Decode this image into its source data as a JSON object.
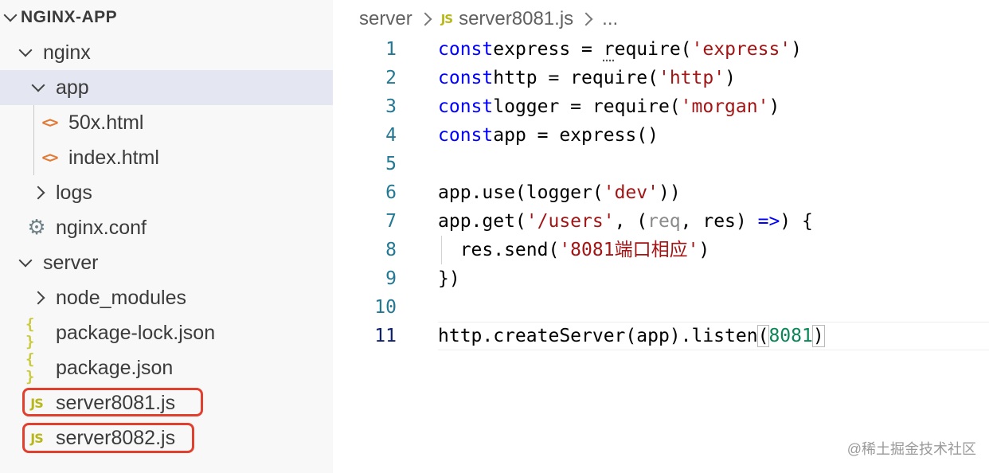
{
  "explorer": {
    "root": "NGINX-APP",
    "items": [
      {
        "label": "nginx",
        "type": "folder",
        "expanded": true
      },
      {
        "label": "app",
        "type": "folder",
        "expanded": true,
        "selected": true
      },
      {
        "label": "50x.html",
        "type": "html"
      },
      {
        "label": "index.html",
        "type": "html"
      },
      {
        "label": "logs",
        "type": "folder",
        "expanded": false
      },
      {
        "label": "nginx.conf",
        "type": "config"
      },
      {
        "label": "server",
        "type": "folder",
        "expanded": true
      },
      {
        "label": "node_modules",
        "type": "folder",
        "expanded": false
      },
      {
        "label": "package-lock.json",
        "type": "json"
      },
      {
        "label": "package.json",
        "type": "json"
      },
      {
        "label": "server8081.js",
        "type": "js",
        "highlighted": true
      },
      {
        "label": "server8082.js",
        "type": "js",
        "highlighted": true
      }
    ],
    "icons": {
      "html": "<>",
      "json": "{ }",
      "js": "JS",
      "config": "⚙"
    },
    "highlight_color": "#e2402f"
  },
  "breadcrumb": {
    "folder": "server",
    "file_icon": "JS",
    "file": "server8081.js",
    "more": "..."
  },
  "editor": {
    "active_line": "11",
    "lines": [
      {
        "n": "1",
        "tokens": [
          [
            "kw",
            "const"
          ],
          [
            "",
            "express = "
          ],
          [
            "dots",
            "r"
          ],
          [
            "",
            "equire("
          ],
          [
            "str",
            "'express'"
          ],
          [
            "",
            ")"
          ]
        ]
      },
      {
        "n": "2",
        "tokens": [
          [
            "kw",
            "const"
          ],
          [
            "",
            "http = require("
          ],
          [
            "str",
            "'http'"
          ],
          [
            "",
            ")"
          ]
        ]
      },
      {
        "n": "3",
        "tokens": [
          [
            "kw",
            "const"
          ],
          [
            "",
            "logger = require("
          ],
          [
            "str",
            "'morgan'"
          ],
          [
            "",
            ")"
          ]
        ]
      },
      {
        "n": "4",
        "tokens": [
          [
            "kw",
            "const"
          ],
          [
            "",
            "app = express()"
          ]
        ]
      },
      {
        "n": "5",
        "tokens": []
      },
      {
        "n": "6",
        "tokens": [
          [
            "",
            "app.use(logger("
          ],
          [
            "str",
            "'dev'"
          ],
          [
            "",
            "))"
          ]
        ]
      },
      {
        "n": "7",
        "tokens": [
          [
            "",
            "app.get("
          ],
          [
            "str",
            "'/users'"
          ],
          [
            "",
            ", ("
          ],
          [
            "dim",
            "req"
          ],
          [
            "",
            ", res) "
          ],
          [
            "kw",
            "=>"
          ],
          [
            "",
            ") {"
          ]
        ]
      },
      {
        "n": "8",
        "tokens": [
          [
            "",
            "  res.send("
          ],
          [
            "str",
            "'8081端口相应'"
          ],
          [
            "",
            ")"
          ]
        ]
      },
      {
        "n": "9",
        "tokens": [
          [
            "",
            "})"
          ]
        ]
      },
      {
        "n": "10",
        "tokens": []
      },
      {
        "n": "11",
        "tokens": [
          [
            "",
            "http.createServer(app).listen"
          ],
          [
            "bm",
            "("
          ],
          [
            "num",
            "8081"
          ],
          [
            "bm",
            ")"
          ]
        ]
      }
    ]
  },
  "watermark": "@稀土掘金技术社区",
  "colors": {
    "keyword": "#0000ff",
    "string": "#a31515",
    "number": "#098658",
    "line_number": "#237893"
  }
}
